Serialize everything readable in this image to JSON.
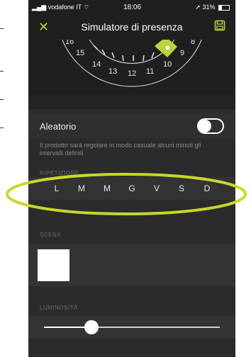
{
  "status_bar": {
    "carrier": "vodafone IT",
    "time": "18:06",
    "battery": "31%"
  },
  "header": {
    "title": "Simulatore di presenza",
    "close_icon": "close-x-icon",
    "save_icon": "floppy-save-icon"
  },
  "dial": {
    "labels": [
      "16",
      "15",
      "14",
      "13",
      "12",
      "11",
      "10",
      "9",
      "8"
    ]
  },
  "aleatorio": {
    "label": "Aleatorio",
    "enabled": false,
    "description": "Il prodotto sarà regolare in modo casuale alcuni minuti gli intervalli definiti"
  },
  "ripetizione": {
    "label": "RIPETIZIONE",
    "days": [
      "L",
      "M",
      "M",
      "G",
      "V",
      "S",
      "D"
    ]
  },
  "scena": {
    "label": "SCENA",
    "swatch_color": "#ffffff"
  },
  "luminosita": {
    "label": "LUMINOSITÀ",
    "level": 0.27
  },
  "colors": {
    "accent": "#b9d53a",
    "highlight_ellipse": "#c9d82a"
  }
}
